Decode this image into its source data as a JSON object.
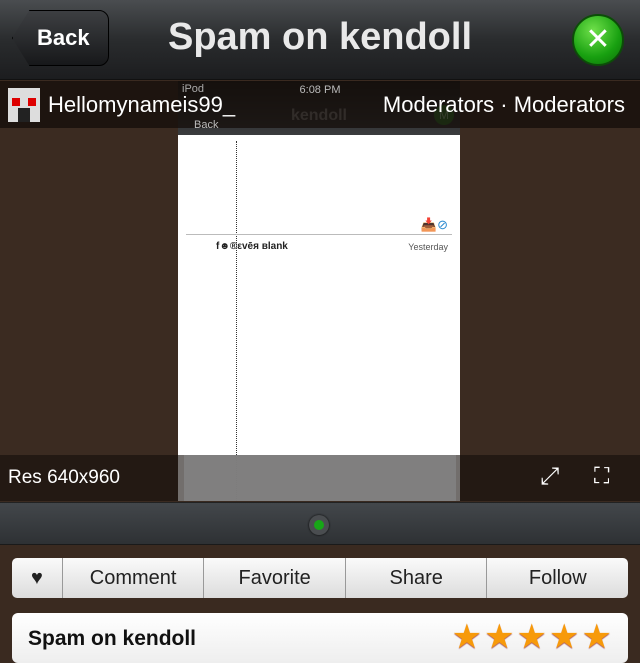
{
  "nav": {
    "back": "Back",
    "title": "Spam on kendoll",
    "tools_icon": "wrench-screwdriver-icon"
  },
  "screenshot": {
    "carrier": "iPod",
    "time": "6:08 PM",
    "back": "Back",
    "title": "kendoll",
    "badge": "M",
    "username": "f☻®εvēя вlank",
    "time_ago": "Yesterday"
  },
  "overlay": {
    "user": "Hellomynameis99_",
    "category": "Moderators · Moderators",
    "resolution": "Res 640x960"
  },
  "actions": {
    "comment": "Comment",
    "favorite": "Favorite",
    "share": "Share",
    "follow": "Follow"
  },
  "card": {
    "title": "Spam on kendoll",
    "rating": 5,
    "rating_max": 5
  }
}
